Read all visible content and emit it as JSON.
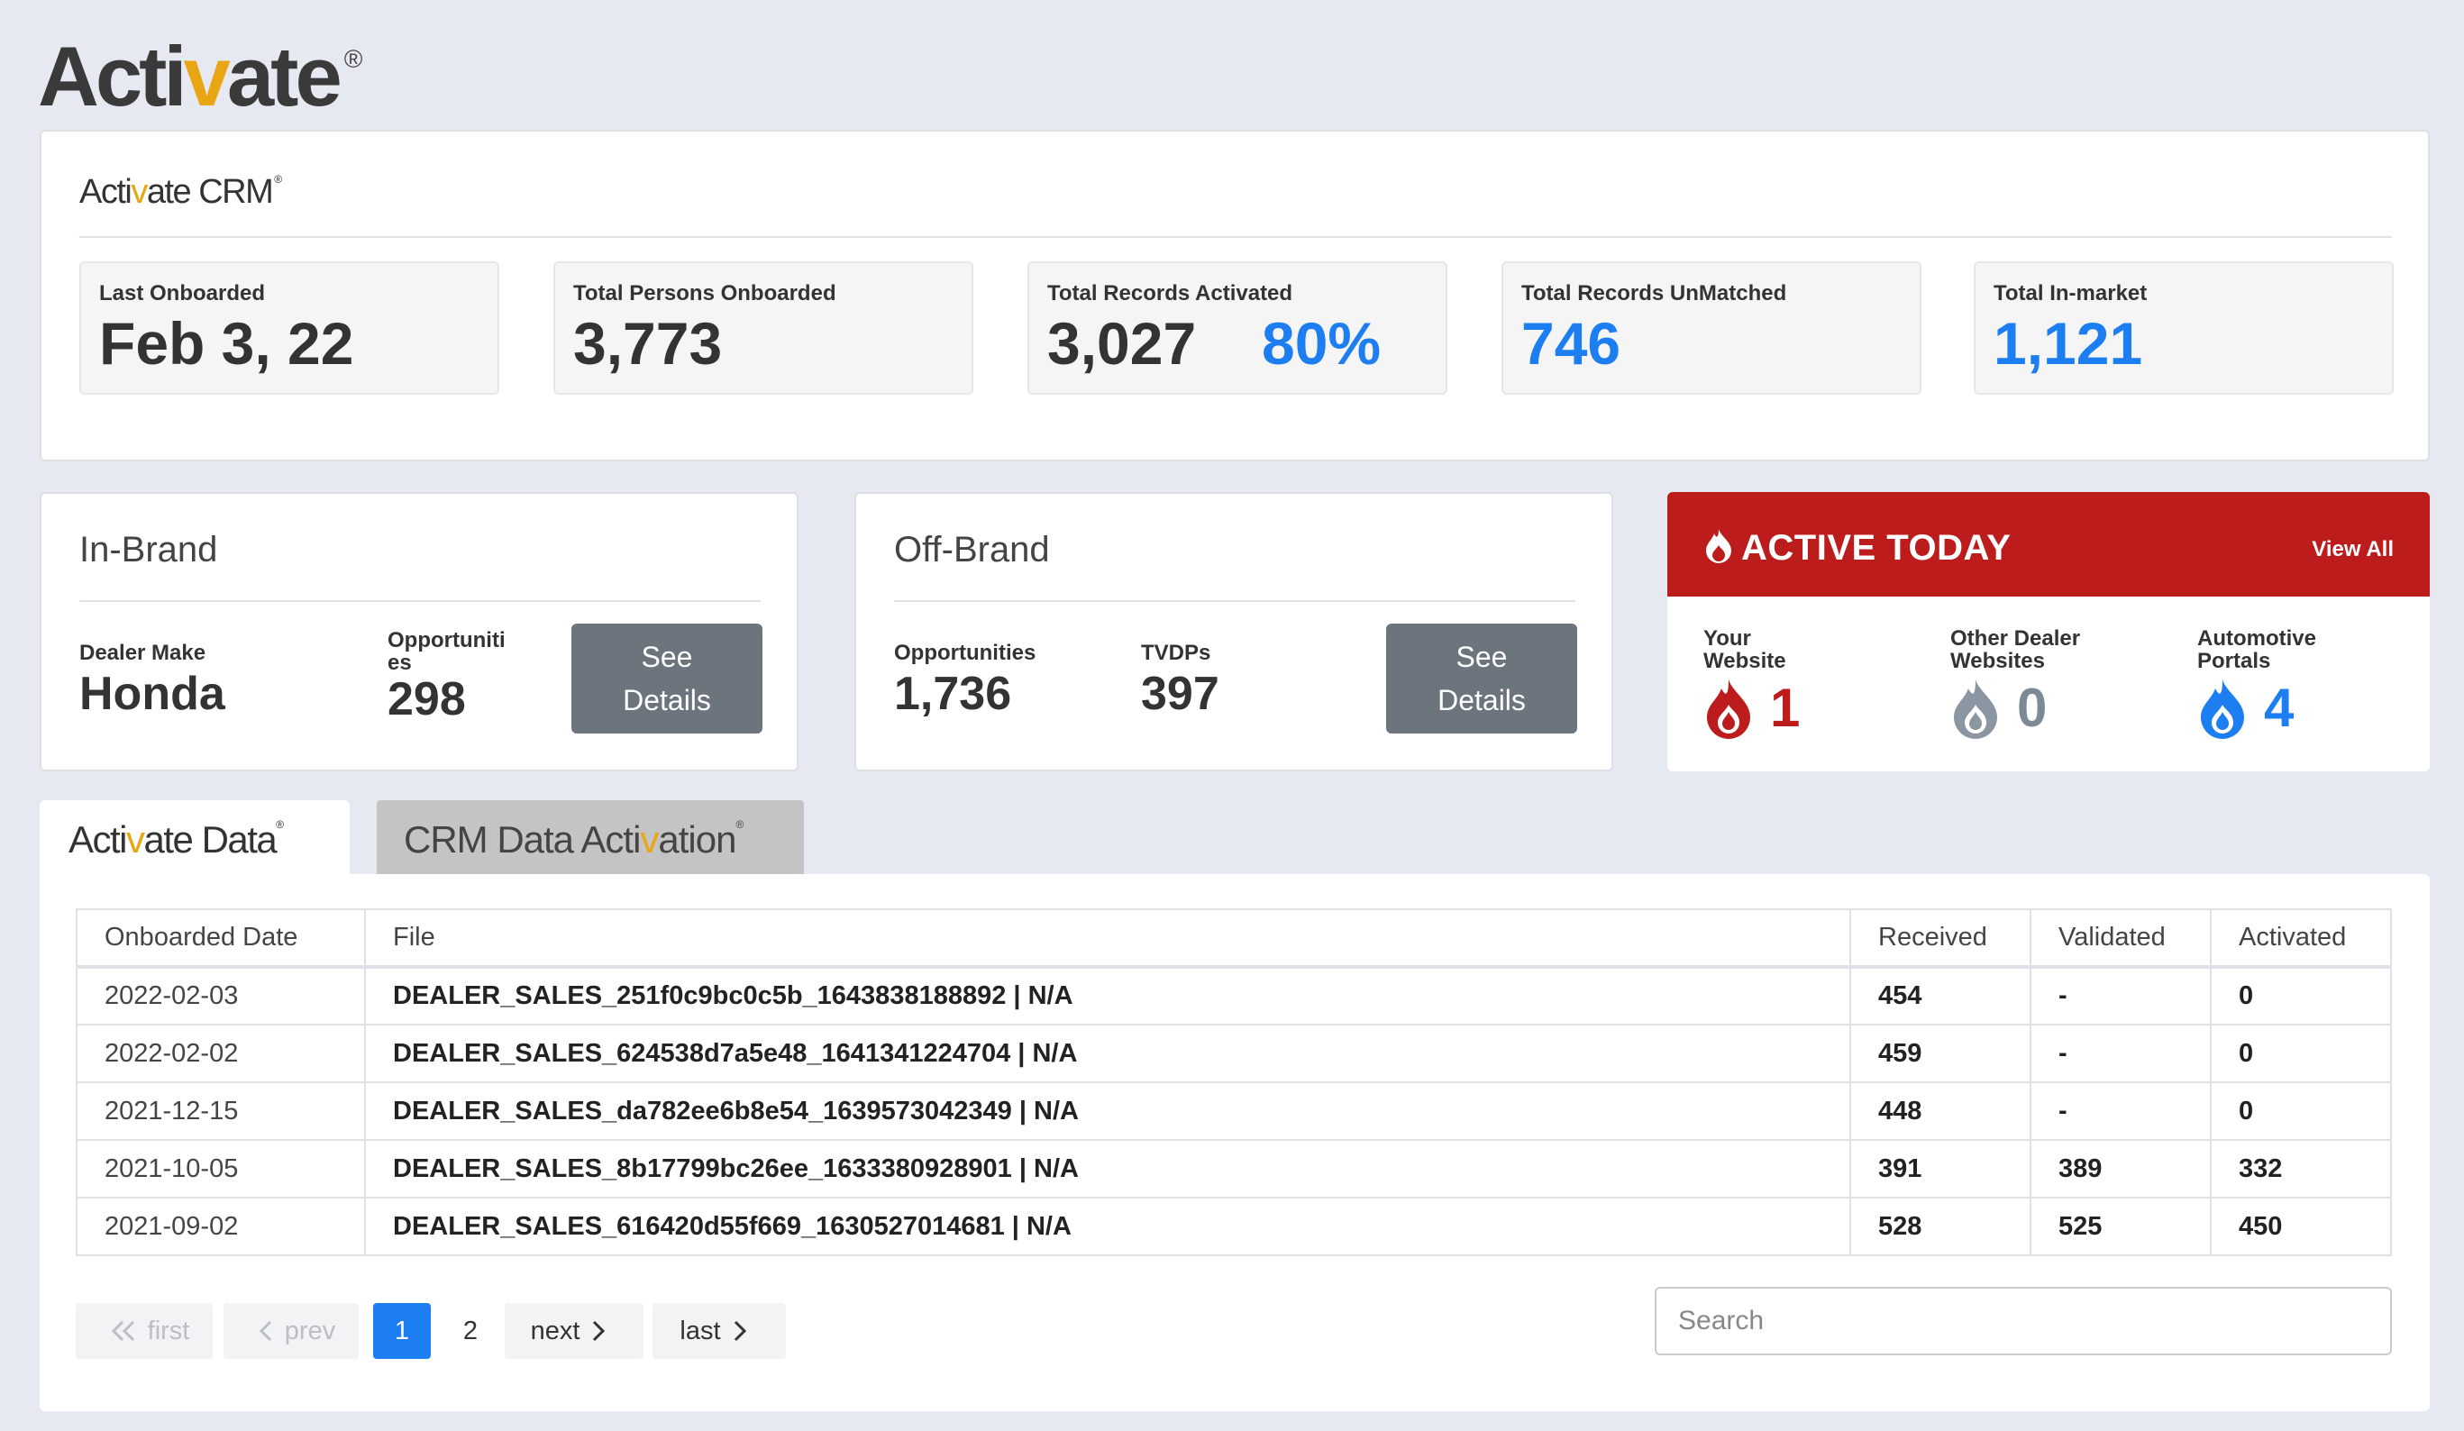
{
  "brand": {
    "logo_text": "Activate",
    "logo_accent_letter": "v",
    "registered": "®"
  },
  "crm": {
    "logo_prefix": "Acti",
    "logo_accent": "v",
    "logo_suffix": "ate CRM",
    "registered": "®",
    "stats": [
      {
        "label": "Last Onboarded",
        "value": "Feb 3, 22"
      },
      {
        "label": "Total Persons Onboarded",
        "value": "3,773"
      },
      {
        "label": "Total Records Activated",
        "value": "3,027",
        "percent": "80%"
      },
      {
        "label": "Total Records UnMatched",
        "value": "746"
      },
      {
        "label": "Total In-market",
        "value": "1,121"
      }
    ]
  },
  "in_brand": {
    "title": "In-Brand",
    "dealer_make_label": "Dealer Make",
    "dealer_make_value": "Honda",
    "opportunities_label_line1": "Opportuniti",
    "opportunities_label_line2": "es",
    "opportunities_value": "298",
    "button_line1": "See",
    "button_line2": "Details"
  },
  "off_brand": {
    "title": "Off-Brand",
    "opportunities_label": "Opportunities",
    "opportunities_value": "1,736",
    "tvdps_label": "TVDPs",
    "tvdps_value": "397",
    "button_line1": "See",
    "button_line2": "Details"
  },
  "active_today": {
    "title": "ACTIVE TODAY",
    "view_all": "View All",
    "items": [
      {
        "label_line1": "Your",
        "label_line2": "Website",
        "value": "1",
        "color": "#bd1c1c",
        "icon": "flame-red-icon"
      },
      {
        "label_line1": "Other Dealer",
        "label_line2": "Websites",
        "value": "0",
        "color": "#7d8a96",
        "icon": "flame-gray-icon"
      },
      {
        "label_line1": "Automotive",
        "label_line2": "Portals",
        "value": "4",
        "color": "#1c7ef0",
        "icon": "flame-blue-icon"
      }
    ]
  },
  "tabs": {
    "tab1": {
      "prefix": "Acti",
      "accent": "v",
      "suffix": "ate Data",
      "registered": "®"
    },
    "tab2": {
      "prefix": "CRM Data Acti",
      "accent": "v",
      "suffix": "ation",
      "registered": "®"
    }
  },
  "table": {
    "headers": [
      "Onboarded Date",
      "File",
      "Received",
      "Validated",
      "Activated"
    ],
    "rows": [
      {
        "date": "2022-02-03",
        "file": "DEALER_SALES_251f0c9bc0c5b_1643838188892 | N/A",
        "received": "454",
        "validated": "-",
        "activated": "0"
      },
      {
        "date": "2022-02-02",
        "file": "DEALER_SALES_624538d7a5e48_1641341224704 | N/A",
        "received": "459",
        "validated": "-",
        "activated": "0"
      },
      {
        "date": "2021-12-15",
        "file": "DEALER_SALES_da782ee6b8e54_1639573042349 | N/A",
        "received": "448",
        "validated": "-",
        "activated": "0"
      },
      {
        "date": "2021-10-05",
        "file": "DEALER_SALES_8b17799bc26ee_1633380928901 | N/A",
        "received": "391",
        "validated": "389",
        "activated": "332"
      },
      {
        "date": "2021-09-02",
        "file": "DEALER_SALES_616420d55f669_1630527014681 | N/A",
        "received": "528",
        "validated": "525",
        "activated": "450"
      }
    ]
  },
  "pagination": {
    "first": "first",
    "prev": "prev",
    "page1": "1",
    "page2": "2",
    "next": "next",
    "last": "last"
  },
  "search": {
    "placeholder": "Search",
    "value": ""
  },
  "colors": {
    "accent_blue": "#1c7ef0",
    "alert_red": "#bd1c1c",
    "logo_gold": "#e8a615",
    "button_gray": "#6c757d"
  }
}
